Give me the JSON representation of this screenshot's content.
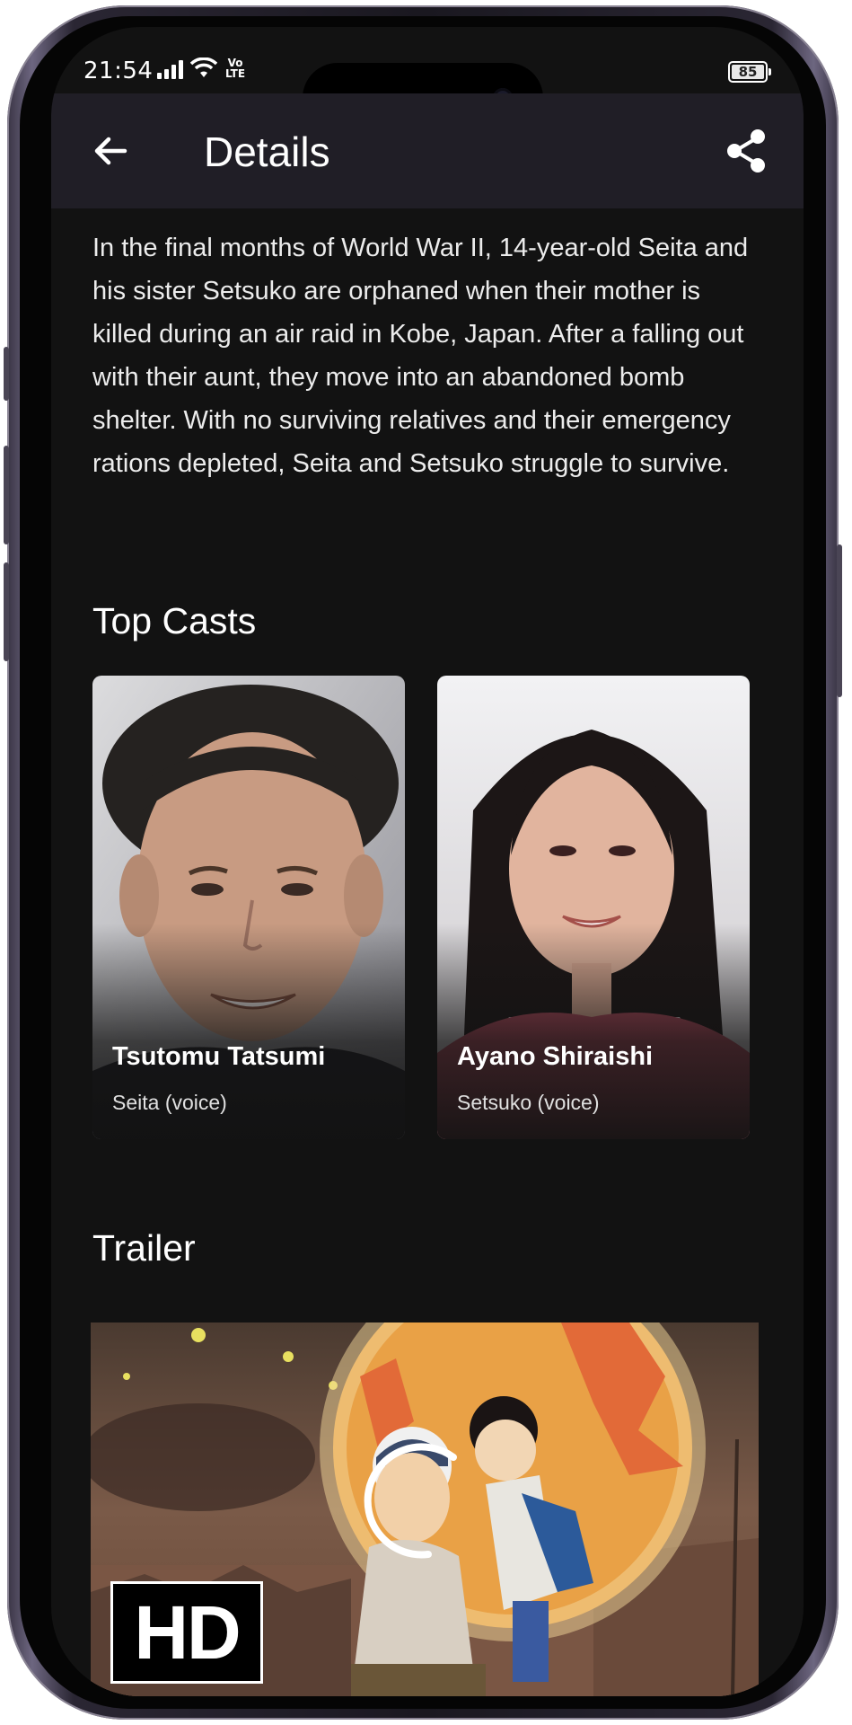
{
  "status_bar": {
    "time": "21:54",
    "network": "Vo LTE",
    "battery": "85"
  },
  "app_bar": {
    "title": "Details"
  },
  "overview": "In the final months of World War II, 14-year-old Seita and his sister Setsuko are orphaned when their mother is killed during an air raid in Kobe, Japan. After a falling out with their aunt, they move into an abandoned bomb shelter. With no surviving relatives and their emergency rations depleted, Seita and Setsuko struggle to survive.",
  "top_casts": {
    "title": "Top Casts",
    "items": [
      {
        "name": "Tsutomu Tatsumi",
        "role": "Seita (voice)"
      },
      {
        "name": "Ayano Shiraishi",
        "role": "Setsuko (voice)"
      }
    ]
  },
  "trailer": {
    "title": "Trailer",
    "badge": "HD"
  },
  "icons": {
    "back": "arrow-left-icon",
    "share": "share-icon",
    "play": "play-icon"
  }
}
